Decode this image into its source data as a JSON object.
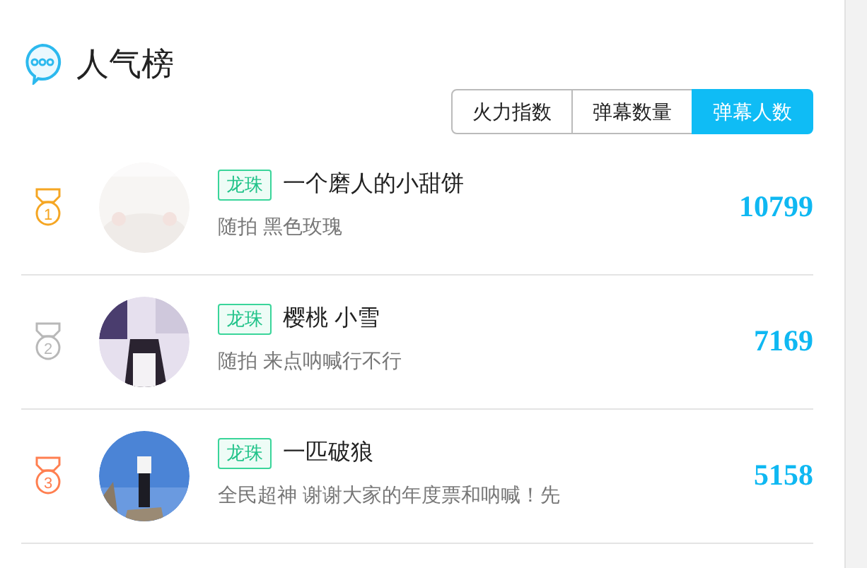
{
  "title": "人气榜",
  "tabs": [
    {
      "label": "火力指数",
      "selected": false
    },
    {
      "label": "弹幕数量",
      "selected": false
    },
    {
      "label": "弹幕人数",
      "selected": true
    }
  ],
  "rows": [
    {
      "rank": "1",
      "color": "#f5a623",
      "tag": "龙珠",
      "name": "一个磨人的小甜饼",
      "subtitle": "随拍 黑色玫瑰",
      "count": "10799"
    },
    {
      "rank": "2",
      "color": "#b8b8b8",
      "tag": "龙珠",
      "name": "樱桃 小雪",
      "subtitle": "随拍 来点呐喊行不行",
      "count": "7169"
    },
    {
      "rank": "3",
      "color": "#ff7f50",
      "tag": "龙珠",
      "name": "一匹破狼",
      "subtitle": "全民超神 谢谢大家的年度票和呐喊！先",
      "count": "5158"
    }
  ]
}
